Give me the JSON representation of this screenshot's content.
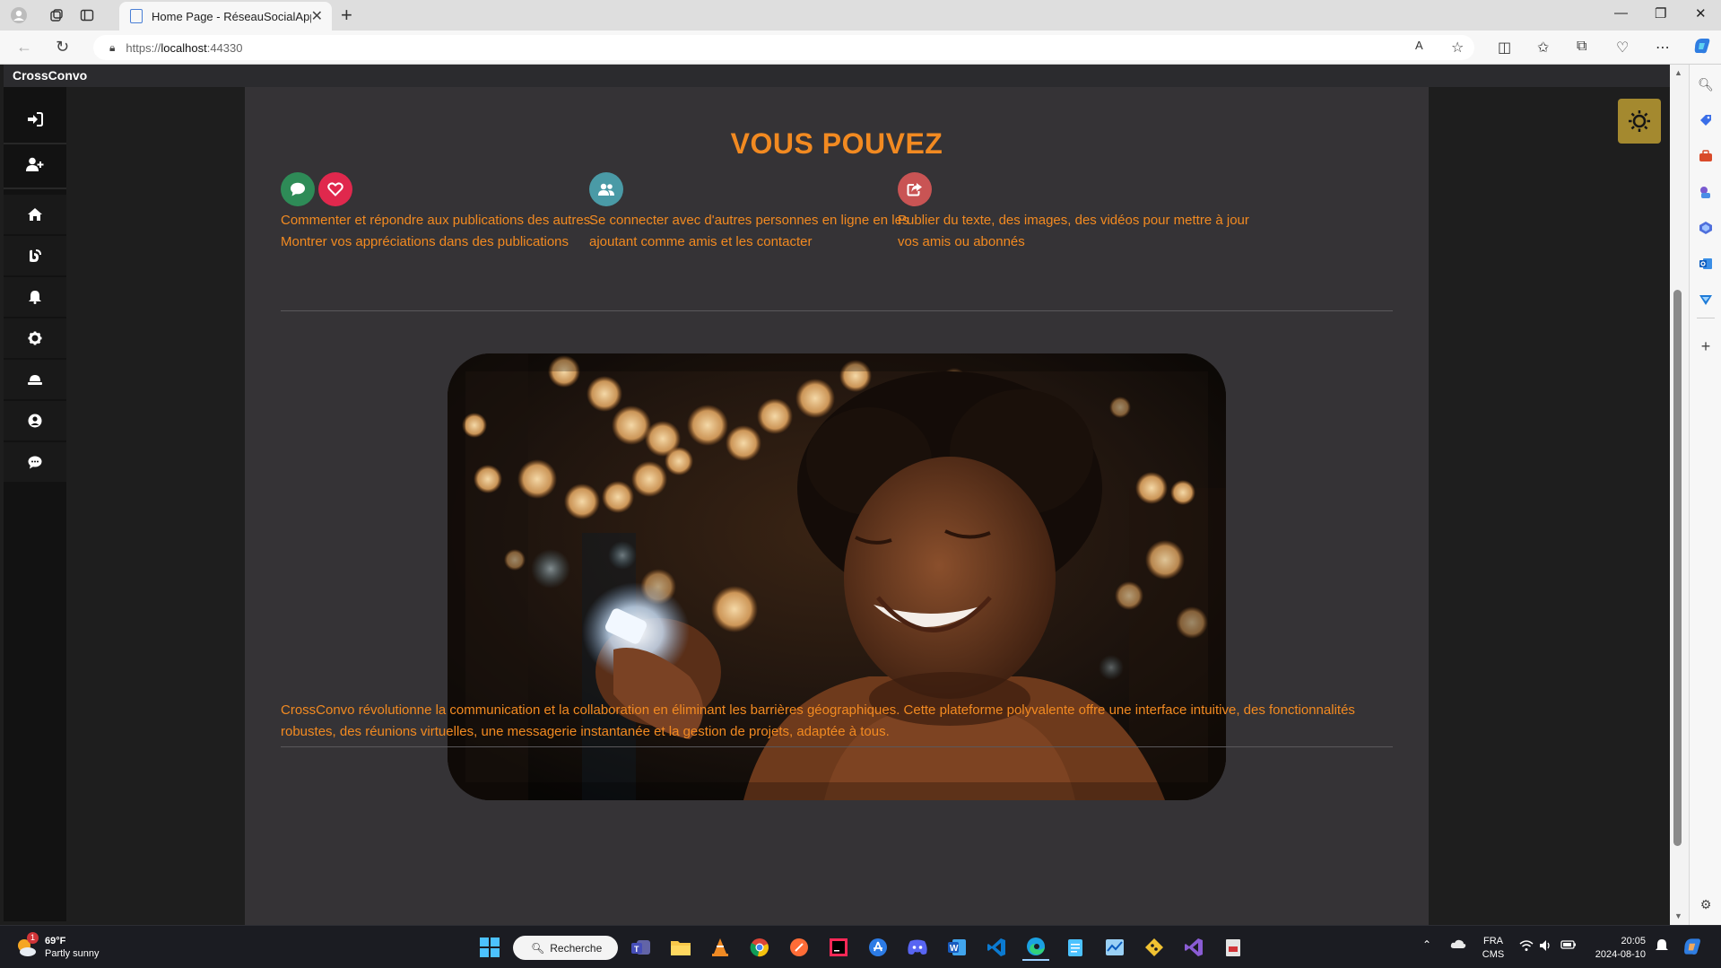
{
  "browser": {
    "tab_title": "Home Page - RéseauSocialApp",
    "url_scheme": "https://",
    "url_host": "localhost",
    "url_port": ":44330"
  },
  "app": {
    "brand": "CrossConvo",
    "heading": "VOUS POUVEZ",
    "features": [
      {
        "text_line1": "Commenter et répondre aux publications des autres.",
        "text_line2": "Montrer vos appréciations dans des publications",
        "icons": [
          "comment-icon",
          "heart-icon"
        ],
        "colors": [
          "#2e8b57",
          "#e0284d"
        ]
      },
      {
        "text_line1": "Se connecter avec d'autres personnes en ligne en les",
        "text_line2": "ajoutant comme amis et les contacter",
        "icons": [
          "users-icon"
        ],
        "colors": [
          "#4a9aa6"
        ]
      },
      {
        "text_line1": "Publier du texte, des images, des vidéos pour mettre à jour",
        "text_line2": "vos amis ou abonnés",
        "icons": [
          "share-icon"
        ],
        "colors": [
          "#c95454"
        ]
      }
    ],
    "description": "CrossConvo révolutionne la communication et la collaboration en éliminant les barrières géographiques. Cette plateforme polyvalente offre une interface intuitive, des fonctionnalités robustes, des réunions virtuelles, une messagerie instantanée et la gestion de projets, adaptée à tous.",
    "nav_icons": [
      "login-icon",
      "user-plus-icon",
      "home-icon",
      "blog-icon",
      "bell-icon",
      "gear-icon",
      "hat-icon",
      "user-circle-icon",
      "chat-icon"
    ],
    "accent_color": "#f28a21",
    "theme_button_color": "#a4892f"
  },
  "taskbar": {
    "weather_temp": "69°F",
    "weather_desc": "Partly sunny",
    "weather_badge": "1",
    "search_label": "Recherche",
    "lang_line1": "FRA",
    "lang_line2": "CMS",
    "time": "20:05",
    "date": "2024-08-10"
  }
}
